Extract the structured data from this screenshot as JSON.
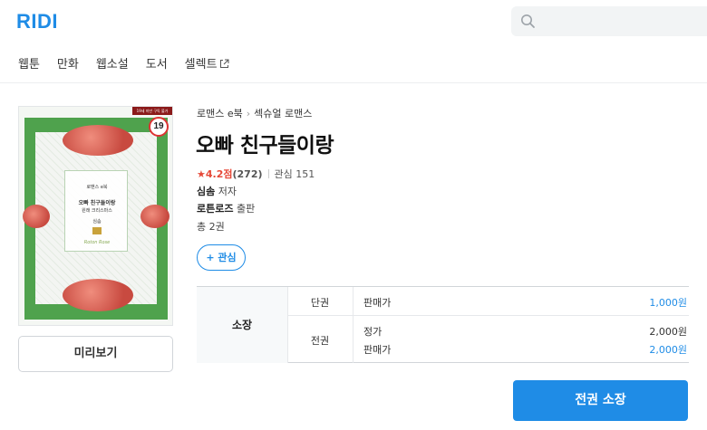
{
  "header": {
    "logo": "RIDI",
    "search_placeholder": ""
  },
  "nav": {
    "items": [
      {
        "label": "웹툰"
      },
      {
        "label": "만화"
      },
      {
        "label": "웹소설"
      },
      {
        "label": "도서"
      },
      {
        "label": "셀렉트"
      }
    ]
  },
  "book": {
    "cover": {
      "age_badge": "19",
      "banner_text": "19세 미만 구독 불가",
      "series_label": "로맨스 e북",
      "cover_title_line1": "오빠 친구들이랑",
      "cover_title_line2": "원래 크리스마스",
      "cover_author": "심솜",
      "publisher_sign": "Roton Rose"
    },
    "preview_label": "미리보기",
    "breadcrumb": [
      "로맨스 e북",
      "섹슈얼 로맨스"
    ],
    "breadcrumb_sep": "›",
    "title": "오빠 친구들이랑",
    "rating_star": "★",
    "rating_score": "4.2점",
    "rating_count": "(272)",
    "interest": "관심 151",
    "author_name": "심솜",
    "author_role": "저자",
    "publisher_name": "로튼로즈",
    "publisher_role": "출판",
    "volumes": "총 2권",
    "wish_label": "+ 관심"
  },
  "pricing": {
    "section_label": "소장",
    "rows": [
      {
        "kind": "단권",
        "label": "판매가",
        "value": "1,000원"
      },
      {
        "kind": "전권",
        "list_label": "정가",
        "list_value": "2,000원",
        "sale_label": "판매가",
        "sale_value": "2,000원"
      }
    ]
  },
  "buy_button": "전권 소장",
  "colors": {
    "accent": "#1f8ce6",
    "rating": "#e64938"
  }
}
